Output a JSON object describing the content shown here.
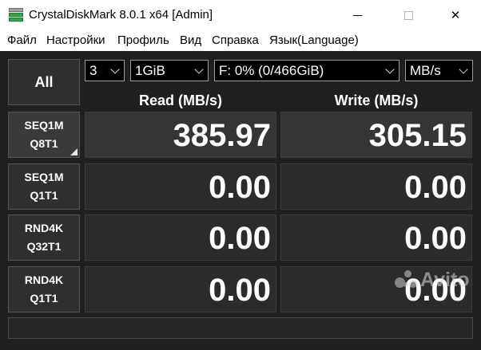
{
  "window": {
    "title": "CrystalDiskMark 8.0.1 x64 [Admin]"
  },
  "menu": [
    "Файл",
    "Настройки",
    "Профиль",
    "Вид",
    "Справка",
    "Язык(Language)"
  ],
  "controls": {
    "all_label": "All",
    "count": "3",
    "size": "1GiB",
    "drive": "F: 0% (0/466GiB)",
    "unit": "MB/s"
  },
  "headers": {
    "read": "Read (MB/s)",
    "write": "Write (MB/s)"
  },
  "tests": [
    {
      "line1": "SEQ1M",
      "line2": "Q8T1",
      "read": "385.97",
      "write": "305.15"
    },
    {
      "line1": "SEQ1M",
      "line2": "Q1T1",
      "read": "0.00",
      "write": "0.00"
    },
    {
      "line1": "RND4K",
      "line2": "Q32T1",
      "read": "0.00",
      "write": "0.00"
    },
    {
      "line1": "RND4K",
      "line2": "Q1T1",
      "read": "0.00",
      "write": "0.00"
    }
  ],
  "watermark": "Avito",
  "colors": {
    "background": "#202020",
    "cell": "#2b2b2b",
    "text": "#ffffff",
    "titlebar": "#ffffff"
  }
}
